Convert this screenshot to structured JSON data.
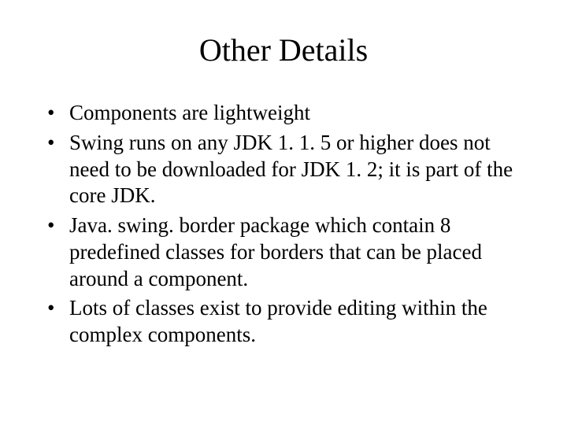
{
  "slide": {
    "title": "Other Details",
    "bullets": [
      "Components are lightweight",
      "Swing runs on any JDK 1. 1. 5 or higher does not need to be downloaded for JDK 1. 2; it is part of the core JDK.",
      "Java. swing. border package which contain 8 predefined classes for borders that can be placed around a component.",
      "Lots of classes exist to provide editing within the complex components."
    ]
  }
}
